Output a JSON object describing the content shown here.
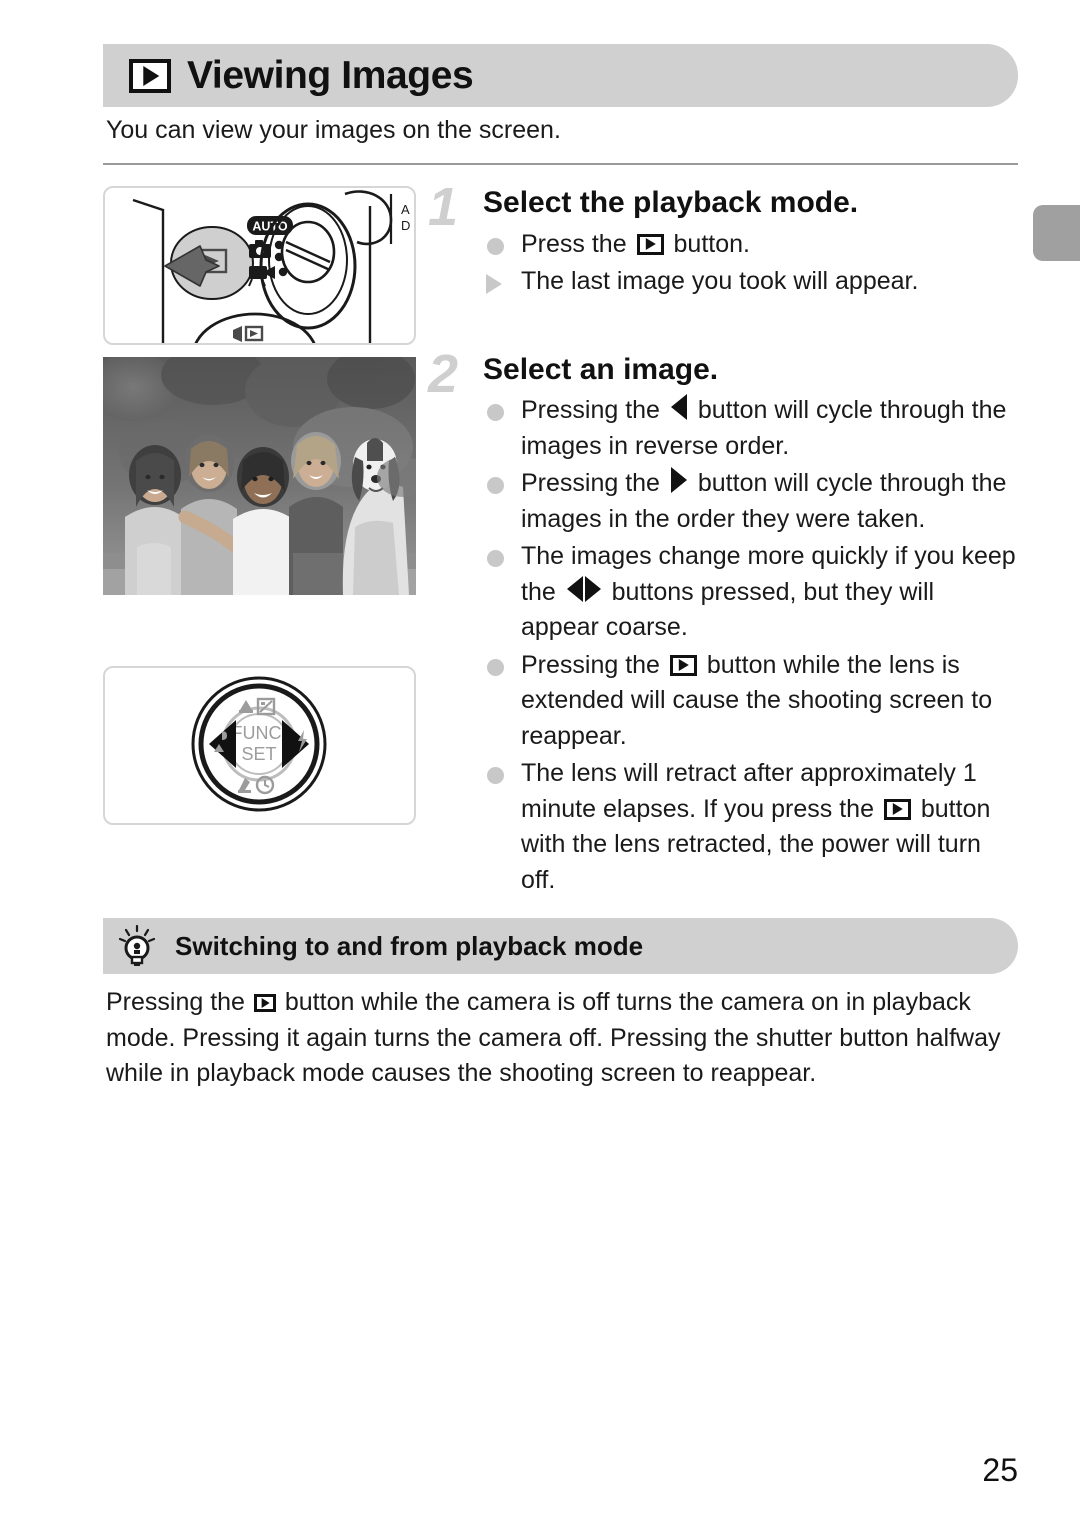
{
  "header": {
    "icon": "playback-icon",
    "title": "Viewing Images"
  },
  "intro": "You can view your images on the screen.",
  "steps": [
    {
      "number": "1",
      "title": "Select the playback mode.",
      "bullets": [
        {
          "marker": "dot",
          "pre": "Press the ",
          "icon": "playback-icon",
          "post": " button."
        },
        {
          "marker": "arrow",
          "pre": "The last image you took will appear.",
          "icon": "",
          "post": ""
        }
      ]
    },
    {
      "number": "2",
      "title": "Select an image.",
      "bullets": [
        {
          "marker": "dot",
          "pre": "Pressing the ",
          "icon": "left-arrow-icon",
          "post": " button will cycle through the images in reverse order."
        },
        {
          "marker": "dot",
          "pre": "Pressing the ",
          "icon": "right-arrow-icon",
          "post": " button will cycle through the images in the order they were taken."
        },
        {
          "marker": "dot",
          "pre": "The images change more quickly if you keep the ",
          "icon": "left-right-arrow-icon",
          "post": " buttons pressed, but they will appear coarse."
        },
        {
          "marker": "dot",
          "pre": "Pressing the ",
          "icon": "playback-icon",
          "post": " button while the lens is extended will cause the shooting screen to reappear."
        },
        {
          "marker": "dot",
          "pre": "The lens will retract after approximately 1 minute elapses. If you press the ",
          "icon": "playback-icon",
          "post": " button with the lens retracted, the power will turn off."
        }
      ]
    }
  ],
  "figures": {
    "camera": {
      "caption": "camera-top-playback-button-illustration",
      "mode_dial_labels": [
        "AUTO",
        "camera-mode-icon",
        "movie-mode-icon"
      ]
    },
    "photo": {
      "caption": "sample-photo-four-children-and-dog-grayscale"
    },
    "wheel": {
      "caption": "control-wheel-illustration",
      "center_label_line1": "FUNC.",
      "center_label_line2": "SET"
    }
  },
  "tip": {
    "icon": "lightbulb-icon",
    "title": "Switching to and from playback mode",
    "body_pre": "Pressing the ",
    "body_icon": "playback-icon",
    "body_post": " button while the camera is off turns the camera on in playback mode. Pressing it again turns the camera off. Pressing the shutter button halfway while in playback mode causes the shooting screen to reappear."
  },
  "page_number": "25",
  "colors": {
    "bar_gray": "#d0d0d0",
    "tab_gray": "#a0a0a0",
    "bullet_gray": "#c8c8c8",
    "step_number_gray": "#cfcfcf",
    "rule_gray": "#9a9a9a"
  }
}
